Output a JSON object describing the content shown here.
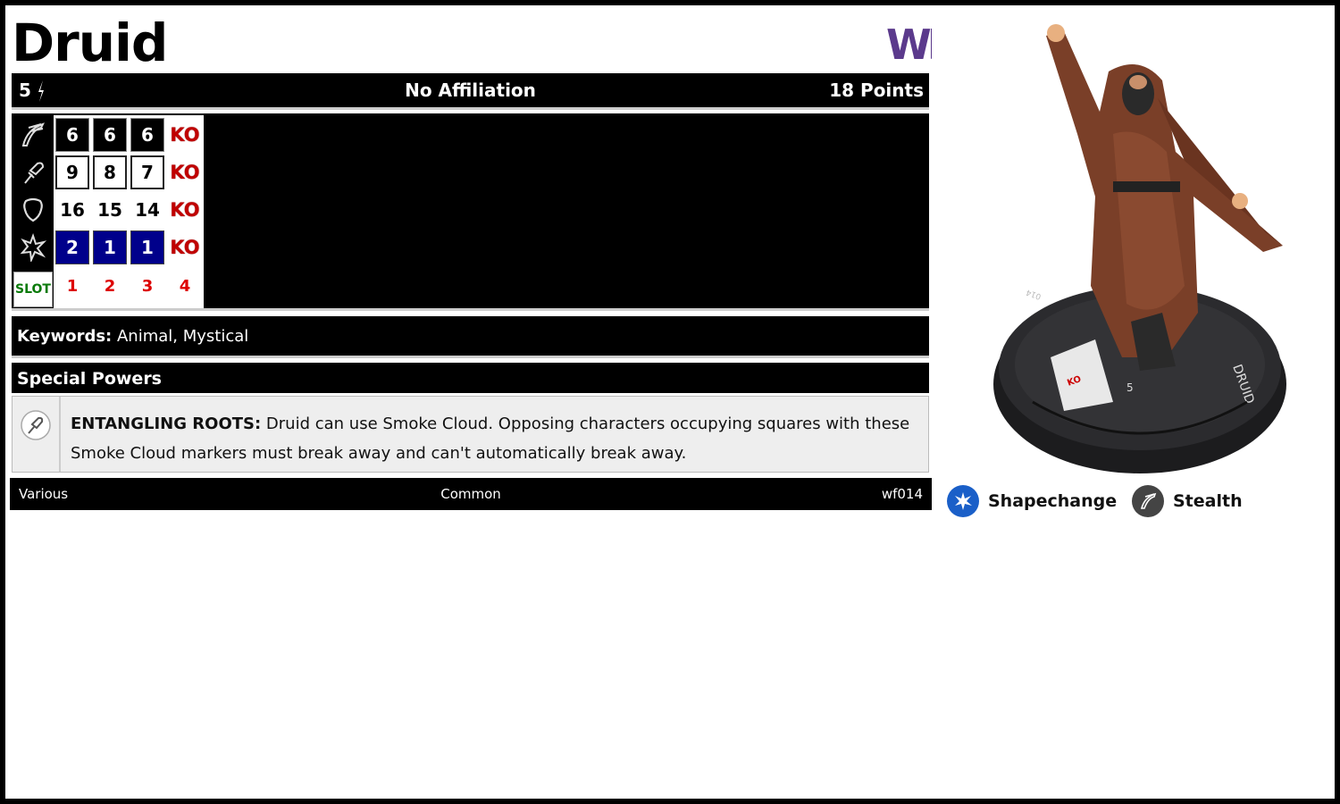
{
  "card": {
    "name": "Druid",
    "set_logo": "WF",
    "level": "5",
    "affiliation": "No Affiliation",
    "points": "18 Points"
  },
  "dial": {
    "stat_icons": [
      "speed-icon",
      "attack-icon",
      "defense-icon",
      "damage-icon"
    ],
    "slot_label": "SLOT",
    "rows": [
      [
        "6",
        "6",
        "6",
        "KO"
      ],
      [
        "9",
        "8",
        "7",
        "KO"
      ],
      [
        "16",
        "15",
        "14",
        "KO"
      ],
      [
        "2",
        "1",
        "1",
        "KO"
      ]
    ],
    "clicks": [
      "1",
      "2",
      "3",
      "4"
    ]
  },
  "keywords": {
    "label": "Keywords:",
    "value": "Animal, Mystical"
  },
  "special_powers": {
    "header": "Special Powers",
    "powers": [
      {
        "name": "ENTANGLING ROOTS:",
        "text": "Druid can use Smoke Cloud. Opposing characters occupying squares with these Smoke Cloud markers must break away and can't automatically break away."
      }
    ]
  },
  "footer": {
    "left": "Various",
    "center": "Common",
    "right": "wf014"
  },
  "figure_base": {
    "name_print": "DRUID",
    "level_print": "5",
    "collector_print": "014"
  },
  "traits": [
    {
      "label": "Shapechange",
      "color": "#1a5fc8",
      "icon": "burst-icon"
    },
    {
      "label": "Stealth",
      "color": "#444444",
      "icon": "speed-icon"
    }
  ],
  "colors": {
    "set_logo": "#5b3a8c",
    "ko": "#c00000",
    "blue_cell": "#00008b",
    "slot_text": "#0a7a0a",
    "click_numbers": "#dd0000"
  }
}
